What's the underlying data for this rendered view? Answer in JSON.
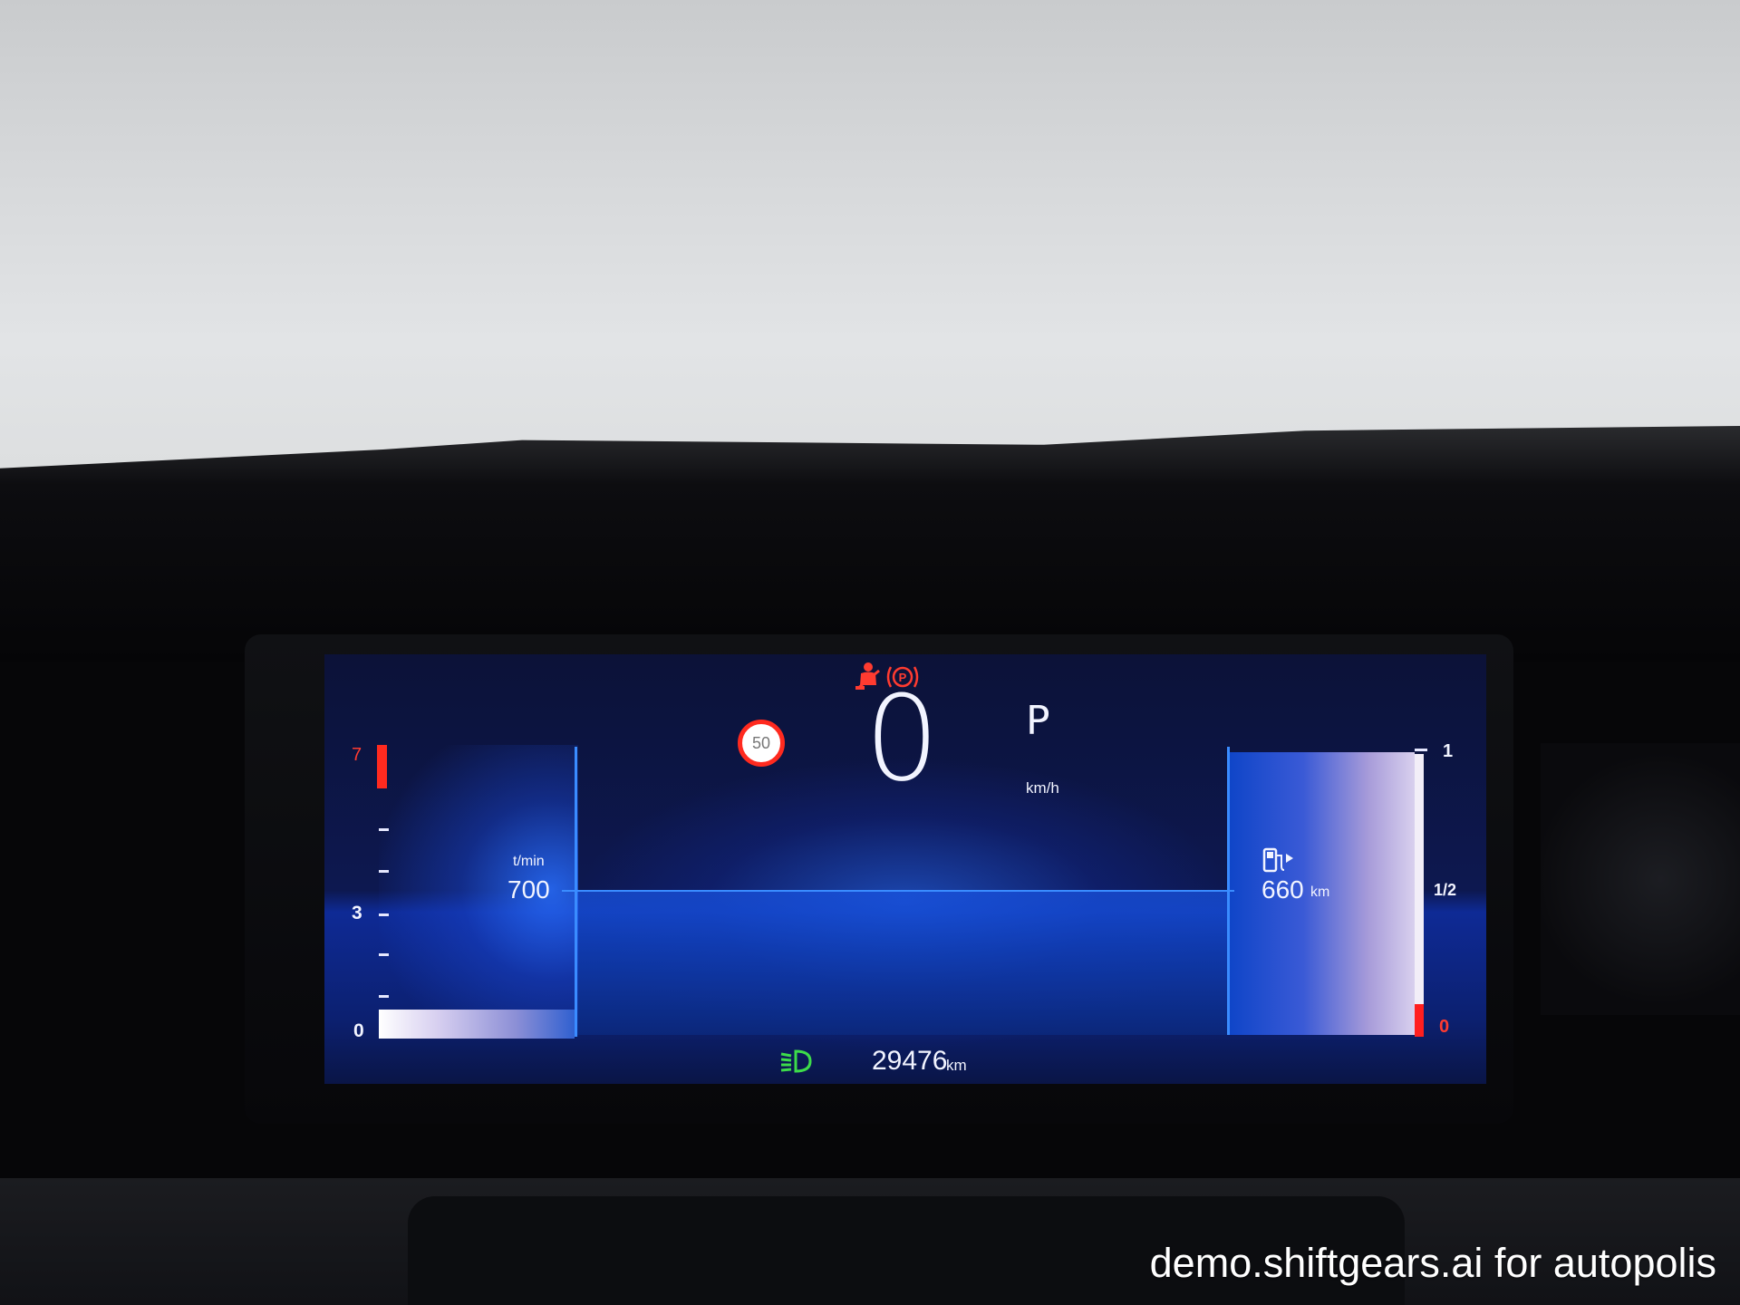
{
  "cluster": {
    "speed": "0",
    "speed_unit": "km/h",
    "gear": "P",
    "speed_limit": "50",
    "rpm_label": "t/min",
    "rpm_value": "700",
    "rpm_scale": {
      "max": "7",
      "mid": "3",
      "min": "0"
    },
    "range_value": "660",
    "range_unit": "km",
    "fuel_scale": {
      "full": "1",
      "half": "1/2",
      "empty": "0"
    },
    "fuel_level": 0.1,
    "odometer_value": "29476",
    "odometer_unit": "km",
    "warning_icons": [
      "seatbelt-warning-icon",
      "parking-brake-icon"
    ],
    "indicator_icons": [
      "headlight-icon",
      "fuel-pump-icon"
    ]
  },
  "watermark": "demo.shiftgears.ai for autopolis",
  "colors": {
    "warning": "#ff3b30",
    "indicator": "#3ddc4a",
    "accent": "#3a8cff"
  }
}
